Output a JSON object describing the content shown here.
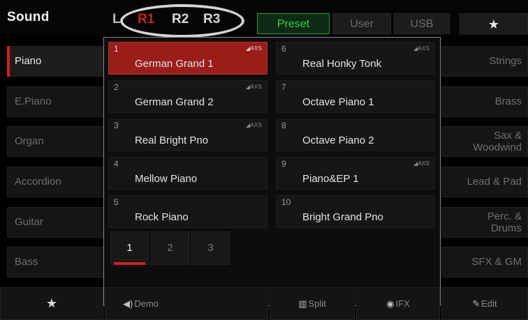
{
  "header": {
    "title": "Sound",
    "parts": [
      "L",
      "R1",
      "R2",
      "R3"
    ],
    "active_part": "R1",
    "tabs": [
      "Preset",
      "User",
      "USB",
      "★"
    ],
    "active_tab": "Preset"
  },
  "categories_left": [
    "Piano",
    "E.Piano",
    "Organ",
    "Accordion",
    "Guitar",
    "Bass"
  ],
  "active_category": "Piano",
  "categories_right": [
    "Strings",
    "Brass",
    "Sax & Woodwind",
    "Lead & Pad",
    "Perc. & Drums",
    "SFX & GM"
  ],
  "voices": [
    {
      "num": "1",
      "name": "German Grand 1",
      "badge": "◢AXS"
    },
    {
      "num": "2",
      "name": "German Grand 2",
      "badge": "◢AXS"
    },
    {
      "num": "3",
      "name": "Real Bright Pno",
      "badge": "◢AXS"
    },
    {
      "num": "4",
      "name": "Mellow Piano",
      "badge": ""
    },
    {
      "num": "5",
      "name": "Rock Piano",
      "badge": ""
    },
    {
      "num": "6",
      "name": "Real Honky Tonk",
      "badge": "◢AXS"
    },
    {
      "num": "7",
      "name": "Octave Piano 1",
      "badge": ""
    },
    {
      "num": "8",
      "name": "Octave Piano 2",
      "badge": ""
    },
    {
      "num": "9",
      "name": "Piano&EP 1",
      "badge": "◢AXS"
    },
    {
      "num": "10",
      "name": "Bright Grand Pno",
      "badge": ""
    }
  ],
  "selected_voice": "1",
  "pages": [
    "1",
    "2",
    "3"
  ],
  "active_page": "1",
  "toolbar": {
    "favorite_icon": "★",
    "demo_icon": "◀)",
    "demo_label": "Demo",
    "split_icon": "▥",
    "split_label": "Split",
    "ifx_icon": "◉",
    "ifx_label": "IFX",
    "edit_icon": "✎",
    "edit_label": "Edit"
  },
  "colors": {
    "accent_red": "#d21f1b",
    "selected_bg": "#9a1d1a",
    "preset_green": "#2fd24c"
  }
}
